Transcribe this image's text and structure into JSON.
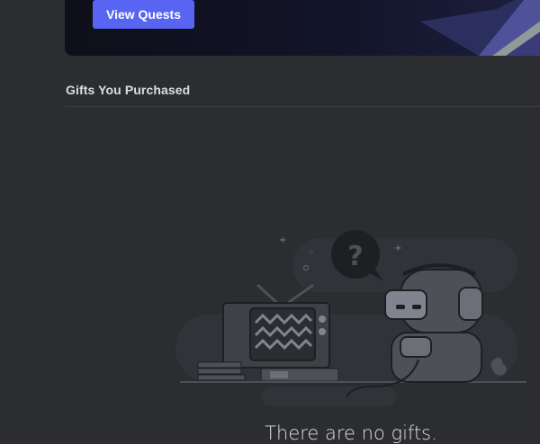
{
  "quests": {
    "button_label": "View Quests"
  },
  "gifts": {
    "section_title": "Gifts You Purchased",
    "empty_message": "There are no gifts."
  },
  "colors": {
    "background": "#2b2d31",
    "accent": "#5865f2",
    "banner": "#121428",
    "text": "#dbdee1"
  }
}
